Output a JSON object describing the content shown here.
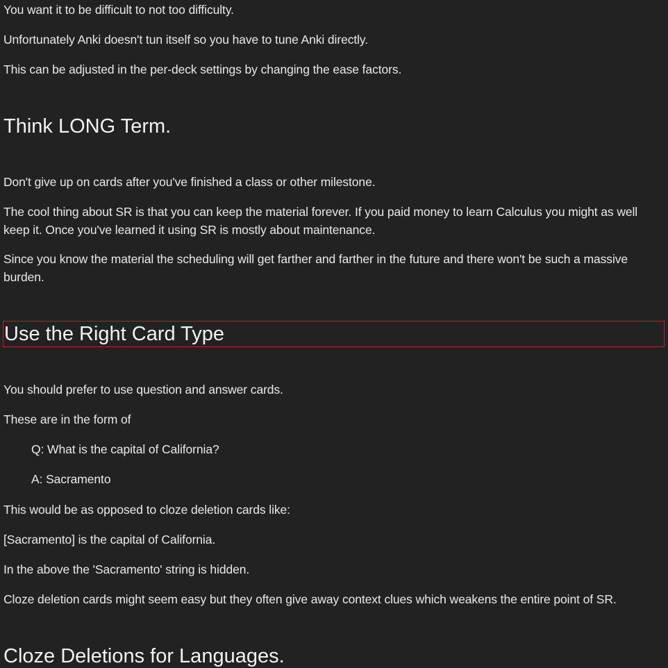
{
  "sections": [
    {
      "paragraphs": [
        "You want it to be difficult to not too difficulty.",
        "Unfortunately Anki doesn't tun itself so you have to tune Anki directly.",
        "This can be adjusted in the per-deck settings by changing the ease factors."
      ]
    },
    {
      "heading": "Think LONG Term.",
      "paragraphs": [
        "Don't give up on cards after you've finished a class or other milestone.",
        "The cool thing about SR is that you can keep the material forever. If you paid money to learn Calculus you might as well keep it. Once you've learned it using SR is mostly about maintenance.",
        "Since you know the material the scheduling will get farther and farther in the future and there won't be such a massive burden."
      ]
    },
    {
      "heading": "Use the Right Card Type",
      "paragraphs": [
        "You should prefer to use question and answer cards.",
        "These are in the form of",
        "Q: What is the capital of California?",
        "A: Sacramento",
        "This would be as opposed to cloze deletion cards like:",
        "[Sacramento] is the capital of California.",
        "In the above the 'Sacramento' string is hidden.",
        "Cloze deletion cards might seem easy but they often give away context clues which weakens the entire point of SR."
      ]
    },
    {
      "heading": "Cloze Deletions for Languages."
    }
  ]
}
